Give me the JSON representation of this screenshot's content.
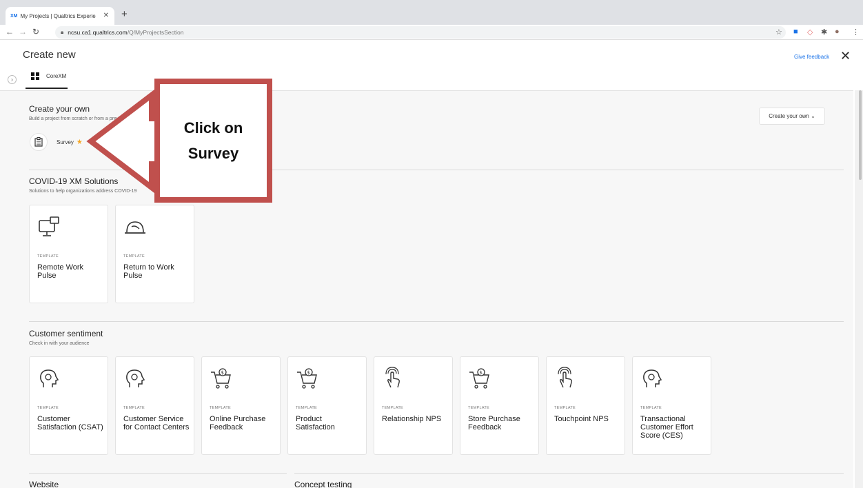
{
  "browser": {
    "tab_title": "My Projects | Qualtrics Experie",
    "tab_icon": "XM",
    "url_host": "ncsu.ca1.qualtrics.com",
    "url_path": "/Q/MyProjectsSection"
  },
  "header": {
    "title": "Create new",
    "tab_label": "CoreXM",
    "feedback": "Give feedback"
  },
  "create_own": {
    "title": "Create your own",
    "subtitle": "Build a project from scratch or from a previous project",
    "survey_label": "Survey",
    "dropdown_label": "Create your own ⌄"
  },
  "covid": {
    "title": "COVID-19 XM Solutions",
    "subtitle": "Solutions to help organizations address COVID-19",
    "cards": [
      {
        "type": "TEMPLATE",
        "name": "Remote Work Pulse",
        "icon": "computer-icon"
      },
      {
        "type": "TEMPLATE",
        "name": "Return to Work Pulse",
        "icon": "hardhat-icon"
      }
    ]
  },
  "customer": {
    "title": "Customer sentiment",
    "subtitle": "Check in with your audience",
    "cards": [
      {
        "type": "TEMPLATE",
        "name": "Customer Satisfaction (CSAT)",
        "icon": "head-icon"
      },
      {
        "type": "TEMPLATE",
        "name": "Customer Service for Contact Centers",
        "icon": "head-icon"
      },
      {
        "type": "TEMPLATE",
        "name": "Online Purchase Feedback",
        "icon": "cart-icon"
      },
      {
        "type": "TEMPLATE",
        "name": "Product Satisfaction",
        "icon": "cart-icon"
      },
      {
        "type": "TEMPLATE",
        "name": "Relationship NPS",
        "icon": "touch-icon"
      },
      {
        "type": "TEMPLATE",
        "name": "Store Purchase Feedback",
        "icon": "cart-icon"
      },
      {
        "type": "TEMPLATE",
        "name": "Touchpoint NPS",
        "icon": "touch-icon"
      },
      {
        "type": "TEMPLATE",
        "name": "Transactional Customer Effort Score (CES)",
        "icon": "head-icon"
      }
    ]
  },
  "website": {
    "title": "Website"
  },
  "concept": {
    "title": "Concept testing"
  },
  "callout": {
    "line1": "Click on",
    "line2": "Survey",
    "accent": "#c0504d"
  }
}
